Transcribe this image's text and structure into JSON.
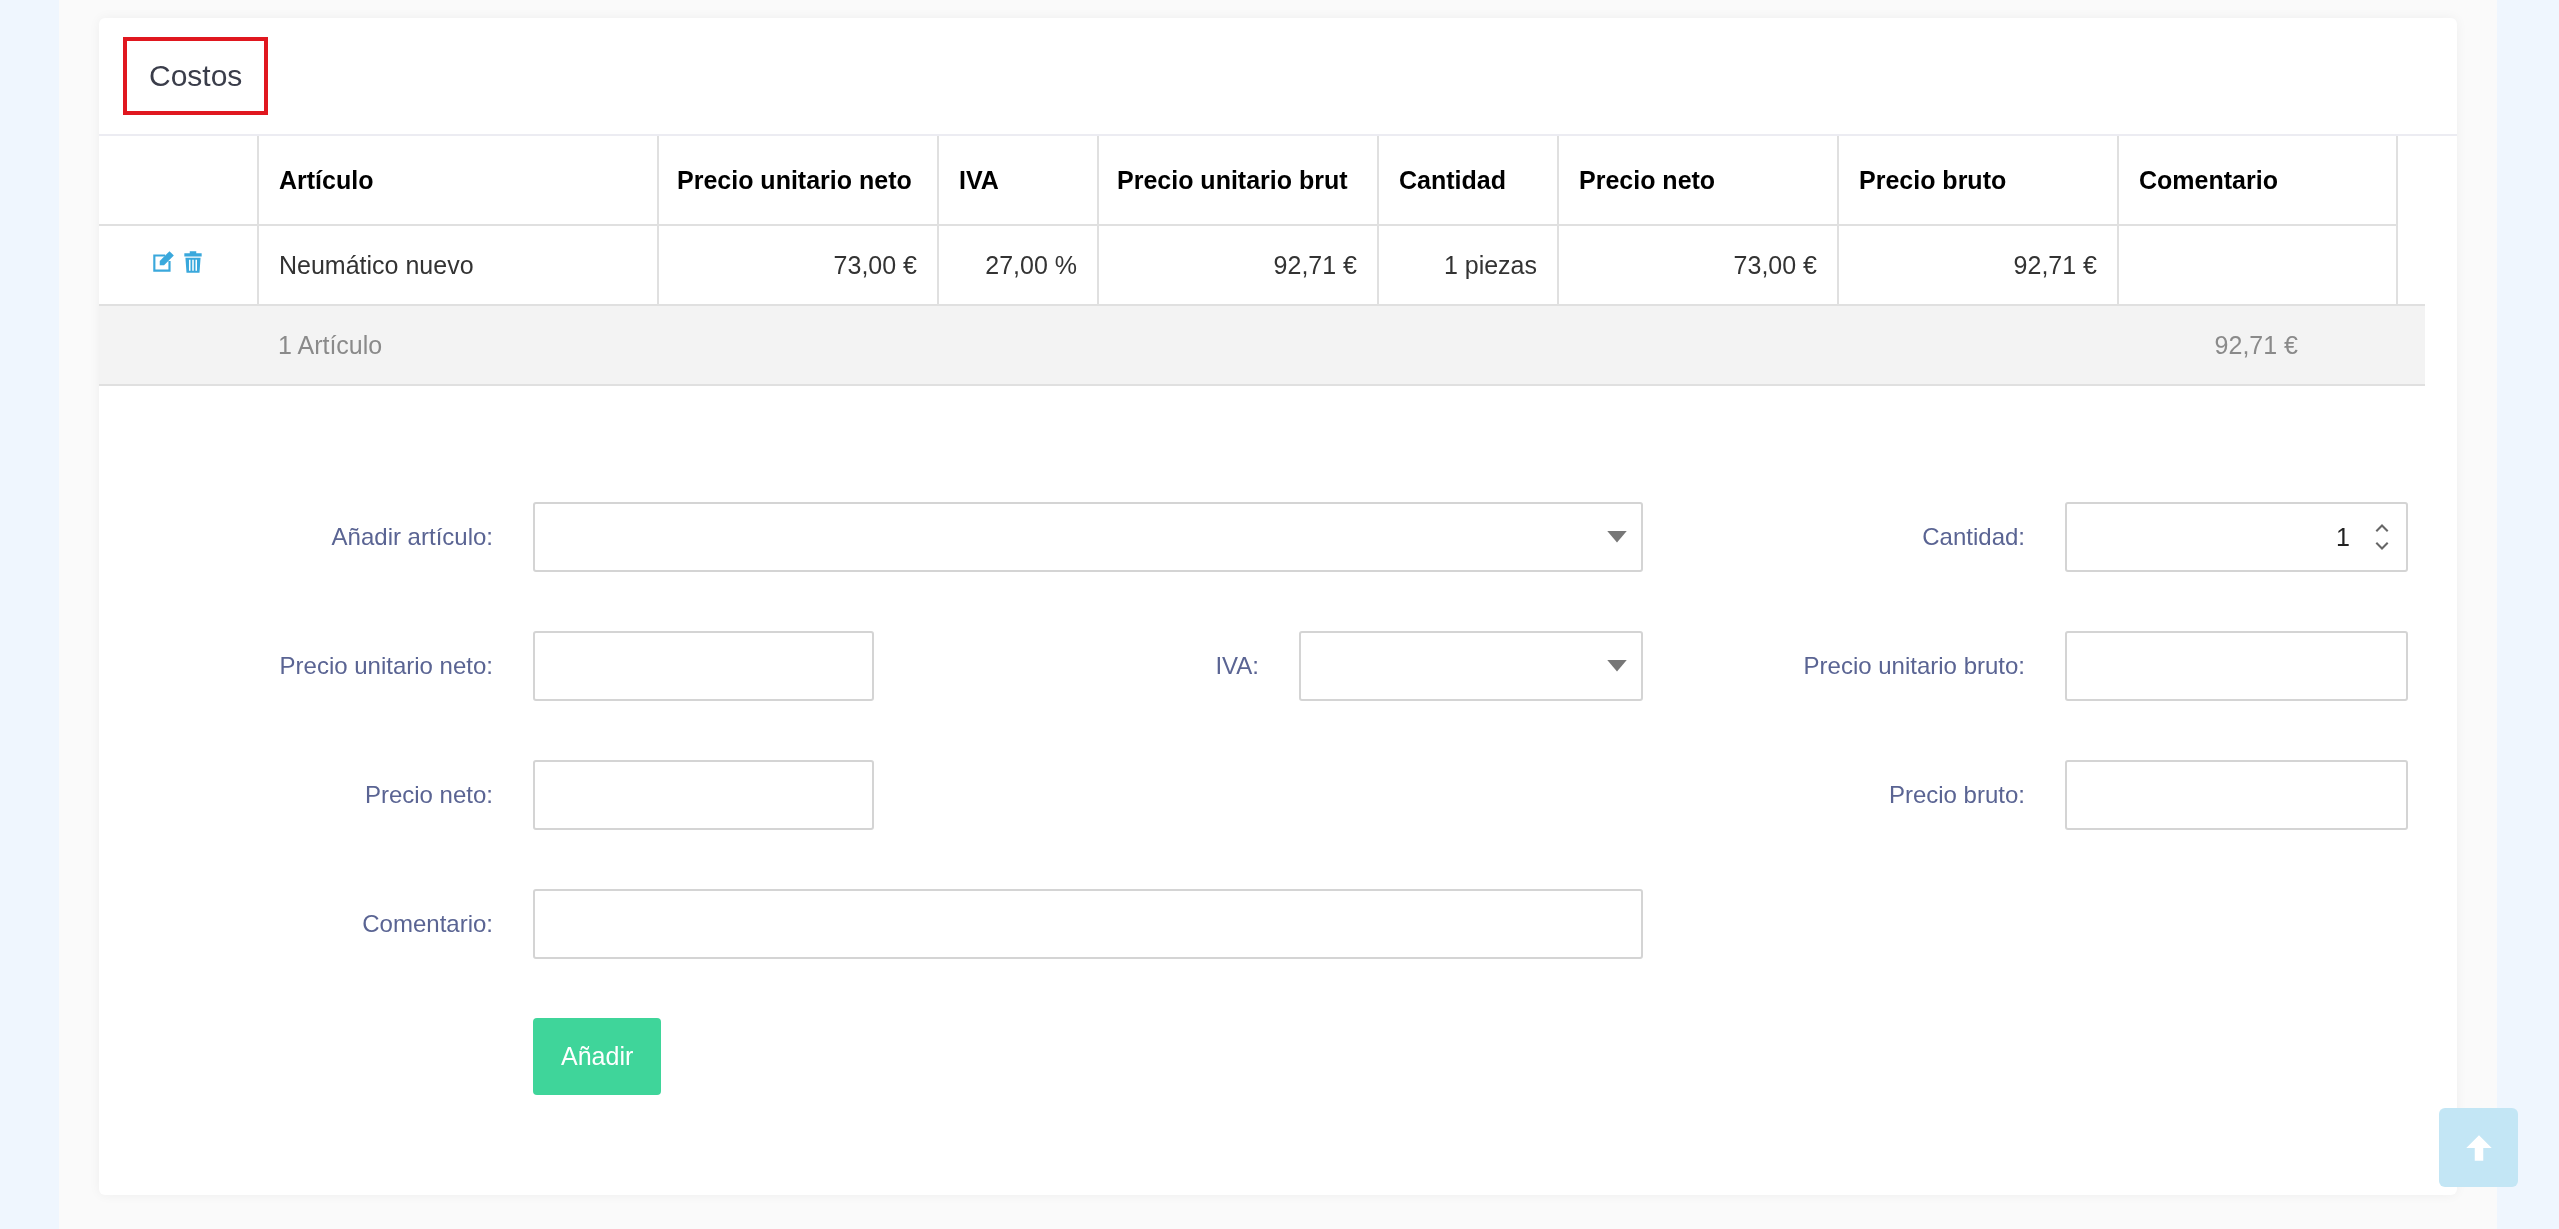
{
  "card": {
    "title": "Costos"
  },
  "table": {
    "columns": [
      "Artículo",
      "Precio unitario neto",
      "IVA",
      "Precio unitario brut",
      "Cantidad",
      "Precio neto",
      "Precio bruto",
      "Comentario"
    ],
    "rows": [
      {
        "cells": [
          "Neumático nuevo",
          "73,00 €",
          "27,00 %",
          "92,71 €",
          "1 piezas",
          "73,00 €",
          "92,71 €",
          ""
        ]
      }
    ],
    "summary": {
      "count": "1 Artículo",
      "total": "92,71 €"
    }
  },
  "form": {
    "add_article": {
      "label": "Añadir artículo:"
    },
    "quantity": {
      "label": "Cantidad:",
      "value": "1"
    },
    "unit_net": {
      "label": "Precio unitario neto:"
    },
    "vat": {
      "label": "IVA:"
    },
    "unit_gross": {
      "label": "Precio unitario bruto:"
    },
    "net": {
      "label": "Precio neto:"
    },
    "gross": {
      "label": "Precio bruto:"
    },
    "comment": {
      "label": "Comentario:"
    },
    "submit": "Añadir"
  }
}
